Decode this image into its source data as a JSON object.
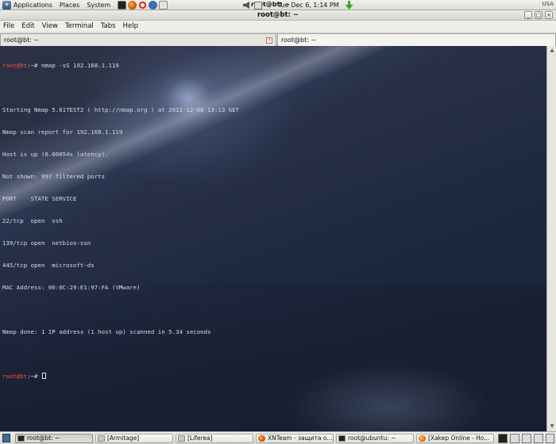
{
  "top_panel": {
    "menus": [
      "Applications",
      "Places",
      "System"
    ],
    "launchers": [
      "terminal-icon",
      "firefox-icon",
      "mail-icon",
      "kde-icon",
      "window-icon"
    ],
    "active_window_title": "root@bt: ~",
    "clock": "Tue Dec  6,  1:14 PM",
    "keyboard_layout": "USA"
  },
  "window": {
    "title": "root@bt: ~",
    "controls": [
      "_",
      "□",
      "×"
    ]
  },
  "menubar": [
    "File",
    "Edit",
    "View",
    "Terminal",
    "Tabs",
    "Help"
  ],
  "tabs": [
    {
      "label": "root@bt: ~",
      "close": "×"
    },
    {
      "label": "root@bt: ~",
      "close": "×"
    }
  ],
  "terminal": {
    "prompt": "root@bt",
    "prompt_suffix": ":~# ",
    "command": "nmap -sS 192.168.1.119",
    "output": [
      "",
      "Starting Nmap 5.61TEST2 ( http://nmap.org ) at 2011-12-06 13:13 GET",
      "Nmap scan report for 192.168.1.119",
      "Host is up (0.00054s latency).",
      "Not shown: 997 filtered ports",
      "PORT    STATE SERVICE",
      "22/tcp  open  ssh",
      "139/tcp open  netbios-ssn",
      "445/tcp open  microsoft-ds",
      "MAC Address: 00:0C:29:E1:97:FA (VMware)",
      "",
      "Nmap done: 1 IP address (1 host up) scanned in 5.34 seconds"
    ]
  },
  "scrollbar": {
    "up": "▲",
    "down": "▼"
  },
  "taskbar": {
    "items": [
      {
        "label": "root@bt: ~",
        "icon": "terminal-icon",
        "active": true
      },
      {
        "label": "[Armitage]",
        "icon": "window-icon",
        "active": false
      },
      {
        "label": "[Liferea]",
        "icon": "window-icon",
        "active": false
      },
      {
        "label": "XNTeam - защита о...",
        "icon": "firefox-icon",
        "active": false
      },
      {
        "label": "root@ubuntu: ~",
        "icon": "terminal-icon",
        "active": false
      },
      {
        "label": "[Xakep Online - Ho...",
        "icon": "firefox-icon",
        "active": false
      }
    ]
  }
}
